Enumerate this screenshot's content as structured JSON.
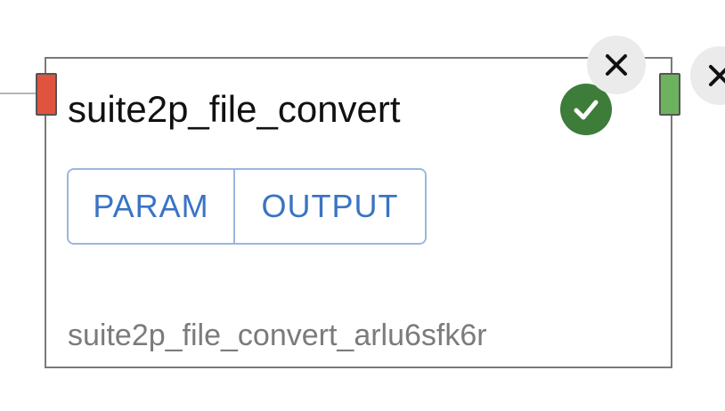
{
  "node": {
    "title": "suite2p_file_convert",
    "id_label": "suite2p_file_convert_arlu6sfk6r",
    "status": "success",
    "buttons": {
      "param": "PARAM",
      "output": "OUTPUT"
    }
  },
  "icons": {
    "status": "check-circle-icon",
    "close": "close-icon"
  },
  "colors": {
    "input_handle": "#e0533f",
    "output_handle": "#6db35d",
    "status_success": "#3e7c3a",
    "button_text": "#3a74c4",
    "button_border": "#9ab7df"
  }
}
